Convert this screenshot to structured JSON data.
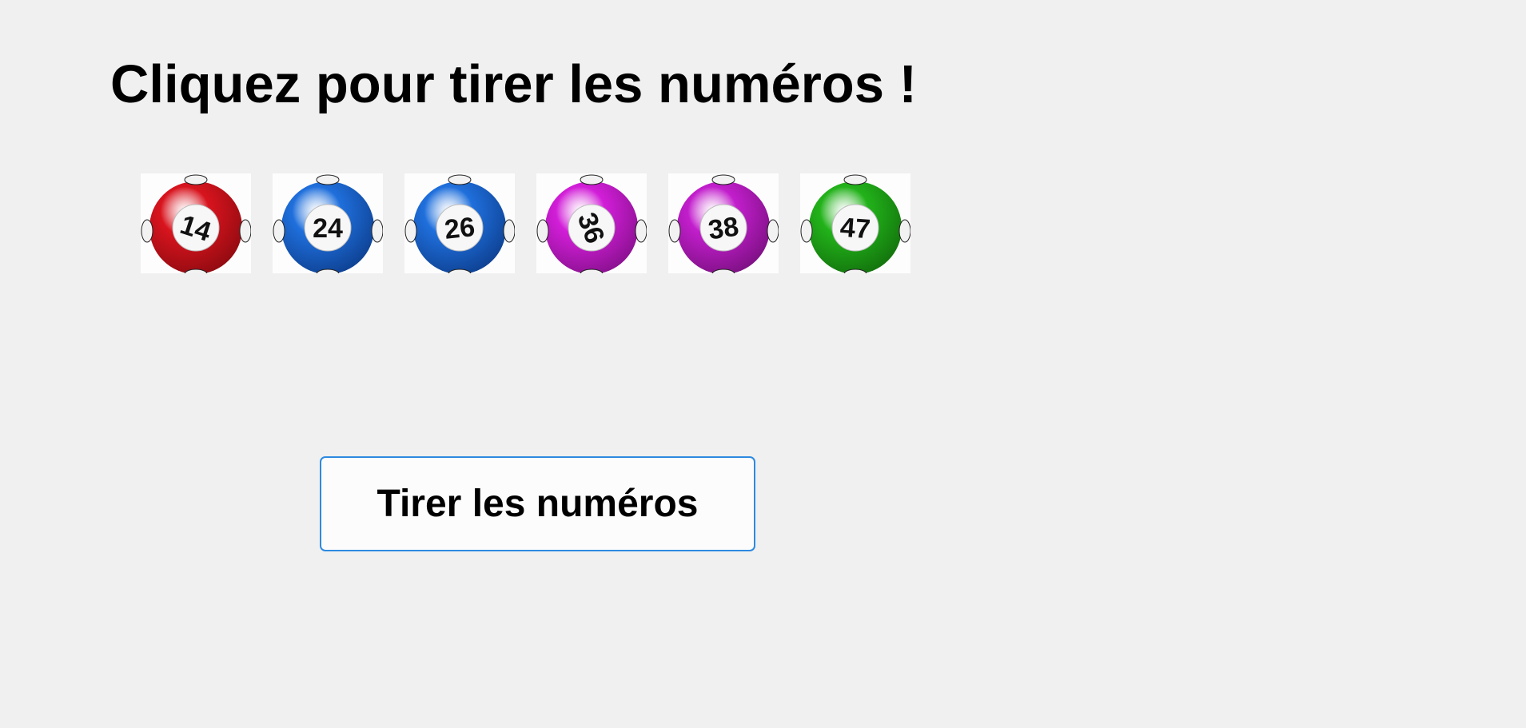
{
  "page": {
    "title": "Cliquez pour tirer les numéros !"
  },
  "balls": [
    {
      "number": "14",
      "color": "#d8141e",
      "shade": "#8e0a10",
      "rotation": 18,
      "icon": "lottery-ball-icon"
    },
    {
      "number": "24",
      "color": "#1f6fdc",
      "shade": "#0d3f8f",
      "rotation": 0,
      "icon": "lottery-ball-icon"
    },
    {
      "number": "26",
      "color": "#1f6fdc",
      "shade": "#0d3f8f",
      "rotation": -6,
      "icon": "lottery-ball-icon"
    },
    {
      "number": "36",
      "color": "#d21ed8",
      "shade": "#86108c",
      "rotation": 70,
      "icon": "lottery-ball-icon"
    },
    {
      "number": "38",
      "color": "#c21ecc",
      "shade": "#7a1080",
      "rotation": -8,
      "icon": "lottery-ball-icon"
    },
    {
      "number": "47",
      "color": "#22b21a",
      "shade": "#12700c",
      "rotation": 4,
      "icon": "lottery-ball-icon"
    }
  ],
  "actions": {
    "draw_label": "Tirer les numéros"
  },
  "colors": {
    "background": "#f0f0f0",
    "button_border": "#2d8ae0"
  }
}
